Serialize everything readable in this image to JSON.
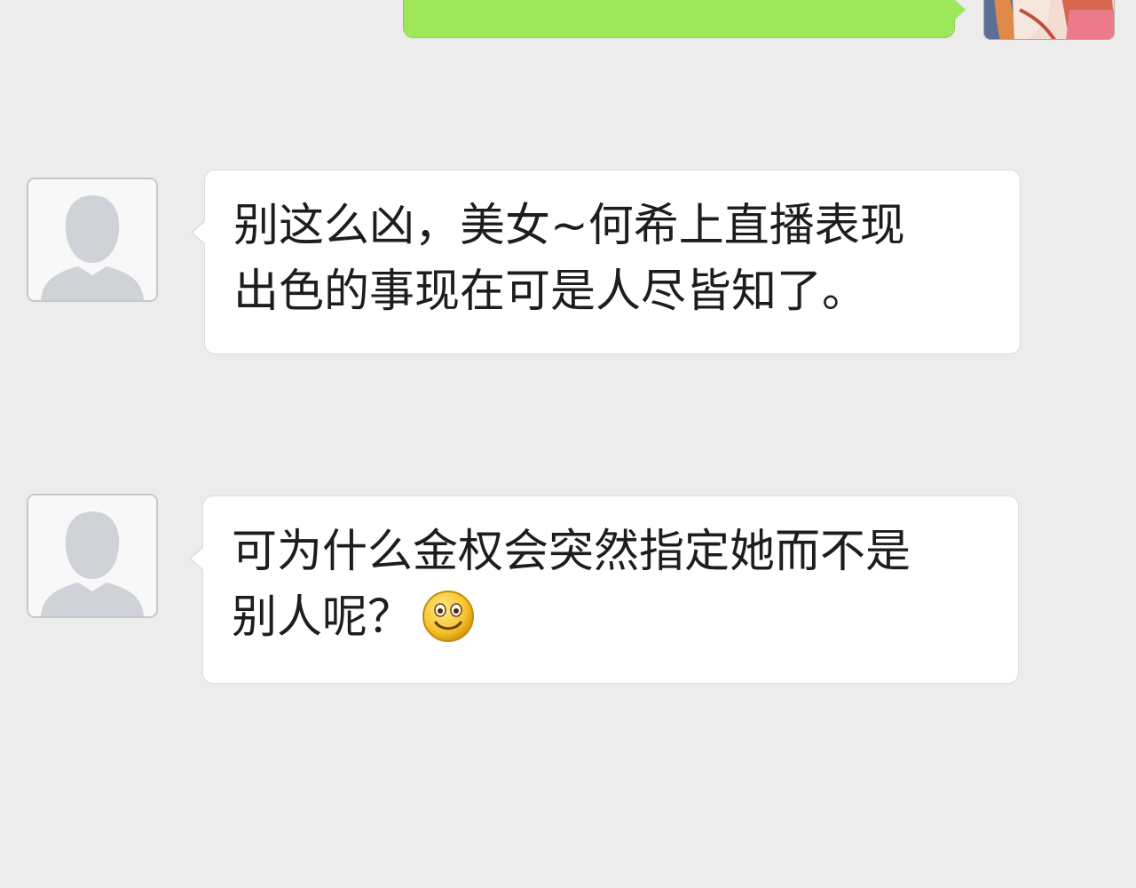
{
  "conversation": {
    "messages": [
      {
        "direction": "incoming",
        "sender_avatar": "default-avatar-icon",
        "lines": [
          "别这么凶，美女~何希上直播表现",
          "出色的事现在可是人尽皆知了。"
        ]
      },
      {
        "direction": "incoming",
        "sender_avatar": "default-avatar-icon",
        "lines": [
          "可为什么金权会突然指定她而不是",
          "别人呢？"
        ],
        "trailing_emoji": "smile-emoji-icon"
      }
    ]
  },
  "colors": {
    "background": "#ececec",
    "outgoing_bubble": "#9fe75a",
    "incoming_bubble": "#ffffff",
    "text": "#1d1d1d"
  }
}
